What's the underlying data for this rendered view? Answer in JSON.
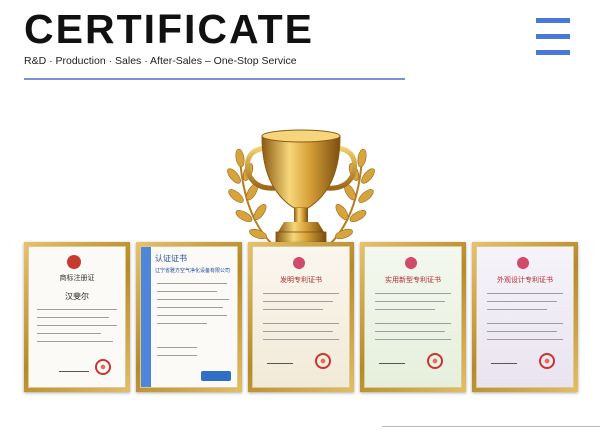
{
  "header": {
    "title": "CERTIFICATE",
    "subtitle": "R&D · Production · Sales · After-Sales – One-Stop Service"
  },
  "colors": {
    "accent": "#4a78d8",
    "rule": "#7b8fd6",
    "gold": "#c9972f",
    "seal_red": "#c7352f"
  },
  "icons": {
    "menu": "hamburger-menu-icon",
    "trophy": "trophy-icon"
  },
  "certificates": [
    {
      "heading": "商标注册证",
      "name": "汉斐尔"
    },
    {
      "heading": "认证证书",
      "name": "辽宁省雅方空气净化设备有限公司"
    },
    {
      "heading": "发明专利证书",
      "name": ""
    },
    {
      "heading": "实用新型专利证书",
      "name": ""
    },
    {
      "heading": "外观设计专利证书",
      "name": ""
    }
  ]
}
